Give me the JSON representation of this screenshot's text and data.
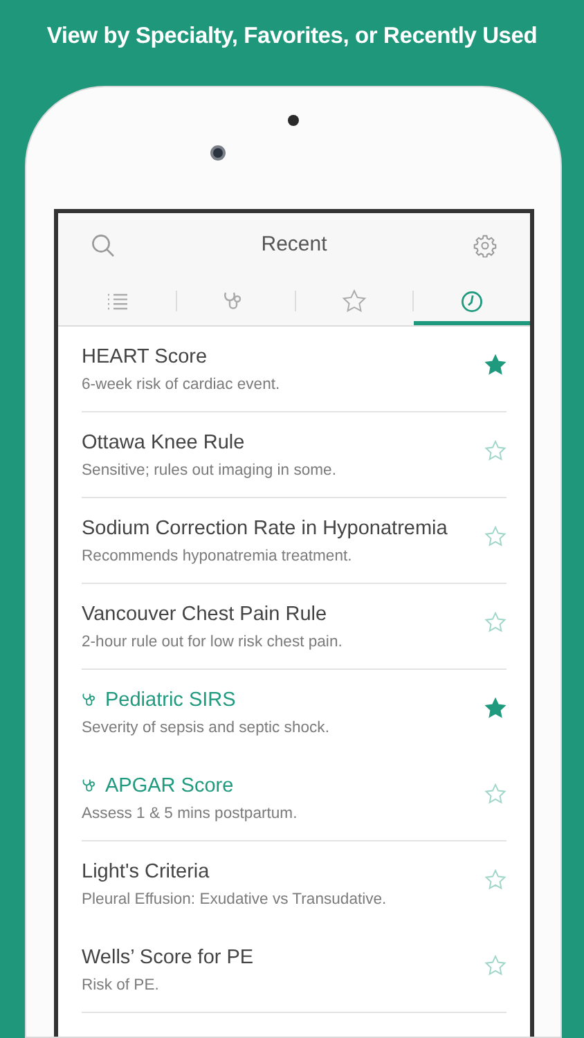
{
  "headline": "View by Specialty, Favorites, or Recently Used",
  "header": {
    "title": "Recent"
  },
  "tabs": [
    {
      "kind": "list",
      "selected": false
    },
    {
      "kind": "specialty",
      "selected": false
    },
    {
      "kind": "favorites",
      "selected": false
    },
    {
      "kind": "recent",
      "selected": true
    }
  ],
  "items": [
    {
      "kind": "plain",
      "title": "HEART Score",
      "subtitle": "6-week risk of cardiac event.",
      "favorite": true,
      "divider_below": true
    },
    {
      "kind": "plain",
      "title": "Ottawa Knee Rule",
      "subtitle": "Sensitive; rules out imaging in some.",
      "favorite": false,
      "divider_below": true
    },
    {
      "kind": "plain",
      "title": "Sodium Correction Rate in Hyponatremia",
      "subtitle": "Recommends hyponatremia treatment.",
      "favorite": false,
      "divider_below": true
    },
    {
      "kind": "plain",
      "title": "Vancouver Chest Pain Rule",
      "subtitle": "2-hour rule out for low risk chest pain.",
      "favorite": false,
      "divider_below": true
    },
    {
      "kind": "specialty",
      "title": "Pediatric SIRS",
      "subtitle": "Severity of sepsis and septic shock.",
      "favorite": true,
      "divider_below": false
    },
    {
      "kind": "specialty",
      "title": "APGAR Score",
      "subtitle": "Assess 1 & 5 mins postpartum.",
      "favorite": false,
      "divider_below": true
    },
    {
      "kind": "plain",
      "title": "Light's Criteria",
      "subtitle": "Pleural Effusion: Exudative vs Transudative.",
      "favorite": false,
      "divider_below": false
    },
    {
      "kind": "plain",
      "title": "Wells’ Score for PE",
      "subtitle": "Risk of PE.",
      "favorite": false,
      "divider_below": true
    }
  ]
}
